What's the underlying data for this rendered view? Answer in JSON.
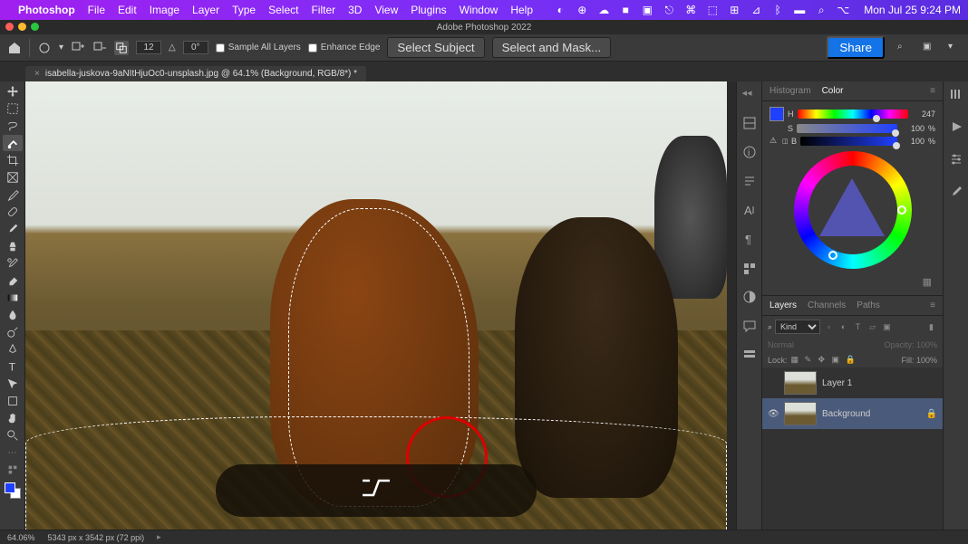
{
  "macbar": {
    "app": "Photoshop",
    "menus": [
      "File",
      "Edit",
      "Image",
      "Layer",
      "Type",
      "Select",
      "Filter",
      "3D",
      "View",
      "Plugins",
      "Window",
      "Help"
    ],
    "clock": "Mon Jul 25  9:24 PM"
  },
  "window_title": "Adobe Photoshop 2022",
  "options": {
    "brush_size": "12",
    "angle_icon": "△",
    "angle": "0°",
    "sample_all": "Sample All Layers",
    "enhance_edge": "Enhance Edge",
    "select_subject": "Select Subject",
    "select_mask": "Select and Mask...",
    "share": "Share"
  },
  "doc_tab": "isabella-juskova-9aNItHjuOc0-unsplash.jpg @ 64.1% (Background, RGB/8*) *",
  "color": {
    "tabs": [
      "Histogram",
      "Color"
    ],
    "h_label": "H",
    "h_val": "247",
    "s_label": "S",
    "s_val": "100",
    "s_unit": "%",
    "b_label": "B",
    "b_val": "100",
    "b_unit": "%"
  },
  "layers": {
    "tabs": [
      "Layers",
      "Channels",
      "Paths"
    ],
    "kind": "Kind",
    "blend": "Normal",
    "opacity_label": "Opacity:",
    "opacity_val": "100%",
    "lock_label": "Lock:",
    "fill_label": "Fill:",
    "fill_val": "100%",
    "items": [
      {
        "name": "Layer 1",
        "visible": false
      },
      {
        "name": "Background",
        "visible": true,
        "locked": true
      }
    ]
  },
  "status": {
    "zoom": "64.06%",
    "dims": "5343 px x 3542 px (72 ppi)"
  },
  "key_hint": "⌥"
}
